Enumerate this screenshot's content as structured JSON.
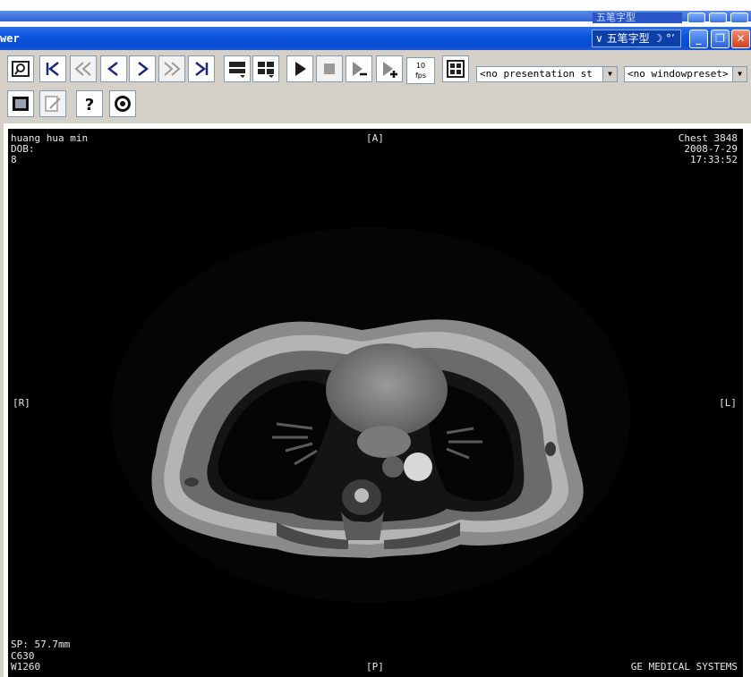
{
  "window": {
    "title_fragment": "wer",
    "ime_label": "五笔字型",
    "ime_extra": "☽ °’",
    "buttons": [
      "minimize",
      "restore",
      "close"
    ]
  },
  "toolbar": {
    "fps_value": "10",
    "fps_unit": "fps",
    "presentation_preset": "<no presentation st",
    "window_preset": "<no windowpreset>",
    "row1_icons": [
      "magnifier-icon",
      "first-image-icon",
      "fast-rewind-icon",
      "previous-image-icon",
      "next-image-icon",
      "fast-forward-icon",
      "last-image-icon",
      "layout-1x1-icon",
      "layout-2x2-icon",
      "play-icon",
      "stop-icon",
      "slower-icon",
      "faster-icon",
      "screen-layout-icon"
    ],
    "row2_icons": [
      "fullscreen-icon",
      "annotate-icon",
      "help-icon",
      "ge-logo-icon"
    ]
  },
  "viewer": {
    "patient_name": "huang hua min",
    "dob_label": "DOB:",
    "series_number": "8",
    "study_name": "Chest 3848",
    "study_date": "2008-7-29",
    "study_time": "17:33:52",
    "orientation_top": "[A]",
    "orientation_bottom": "[P]",
    "orientation_left": "[R]",
    "orientation_right": "[L]",
    "slice_position": "SP: 57.7mm",
    "window_center": "C630",
    "window_width": "W1260",
    "manufacturer": "GE MEDICAL SYSTEMS"
  }
}
